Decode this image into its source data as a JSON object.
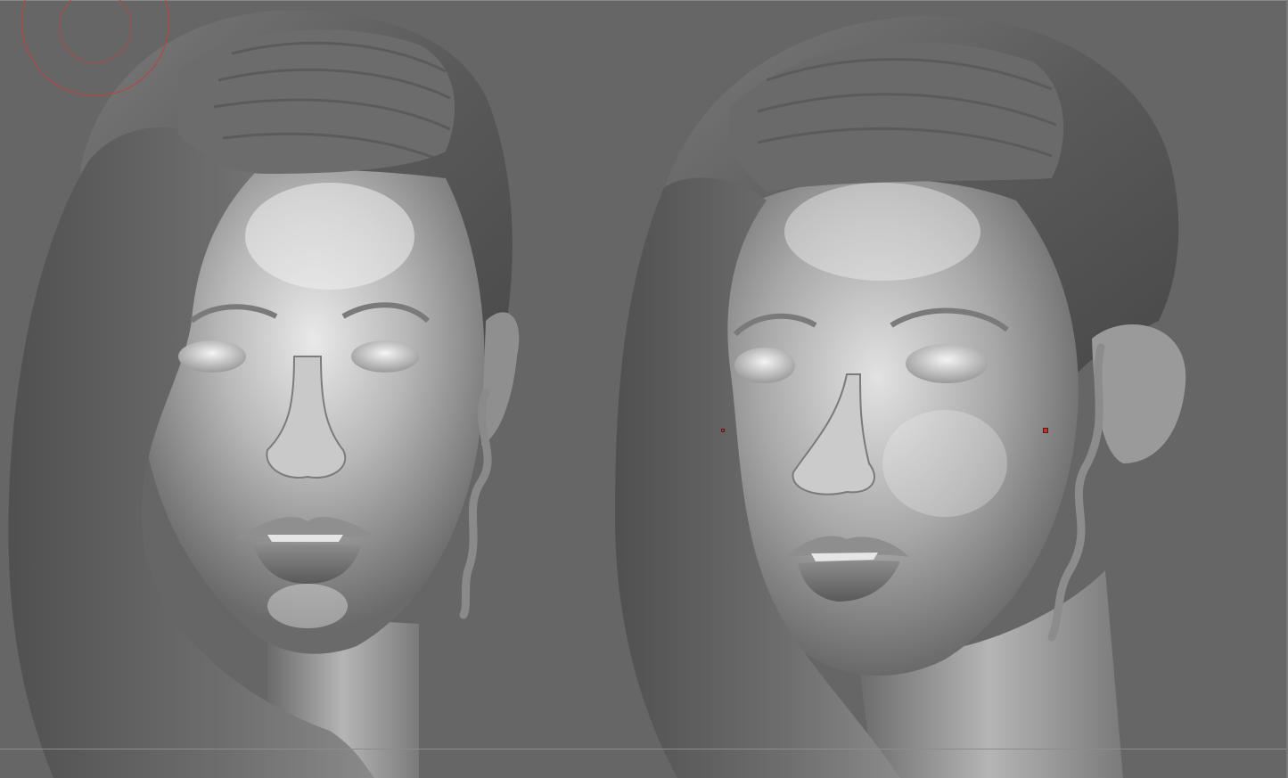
{
  "viewport": {
    "background_color": "#666666",
    "clay_color": "#9a9a9a",
    "highlight_color": "#e8e8e8",
    "cursor_color": "#c0403c",
    "marker_color": "#c3302b"
  },
  "models": [
    {
      "id": "front-view"
    },
    {
      "id": "three-quarter-view"
    }
  ],
  "icons": {
    "brush": "brush-cursor-icon",
    "marker": "red-square-marker-icon"
  }
}
